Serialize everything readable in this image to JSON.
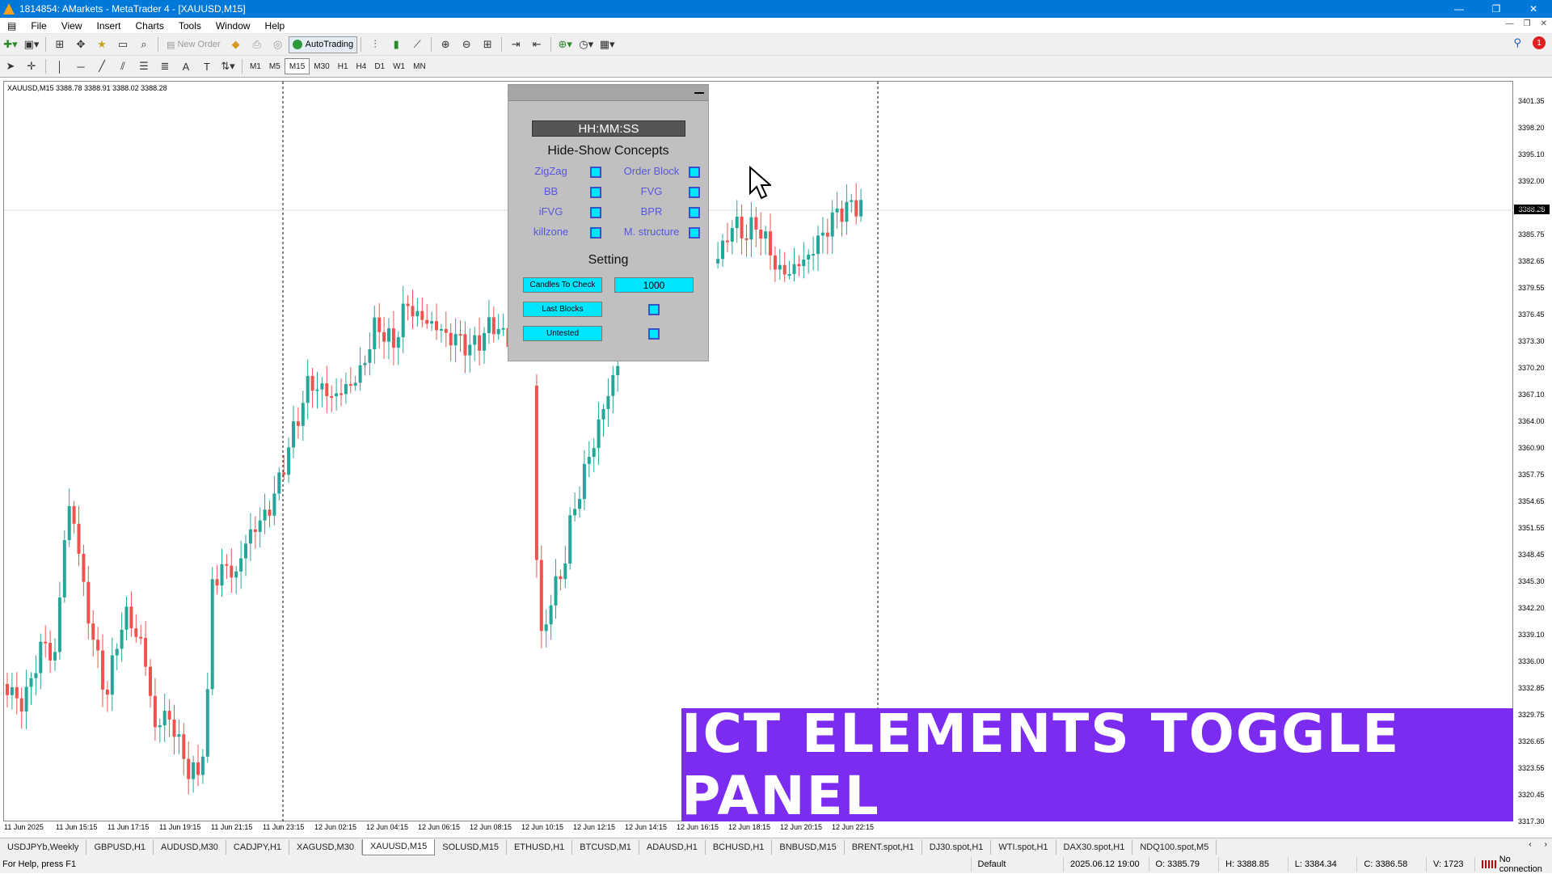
{
  "window": {
    "title": "1814854: AMarkets - MetaTrader 4 - [XAUUSD,M15]",
    "controls": [
      "—",
      "❐",
      "✕"
    ]
  },
  "menu": [
    "File",
    "View",
    "Insert",
    "Charts",
    "Tools",
    "Window",
    "Help"
  ],
  "toolbar": {
    "new_order": "New Order",
    "autotrading": "AutoTrading",
    "notification_count": "1"
  },
  "timeframes": [
    "M1",
    "M5",
    "M15",
    "M30",
    "H1",
    "H4",
    "D1",
    "W1",
    "MN"
  ],
  "active_timeframe": "M15",
  "chart": {
    "info": "XAUUSD,M15  3388.78 3388.91 3388.02 3388.28",
    "current_price": "3388.28",
    "price_ticks": [
      "3401.35",
      "3398.20",
      "3395.10",
      "3392.00",
      "3388.80",
      "3385.75",
      "3382.65",
      "3379.55",
      "3376.45",
      "3373.30",
      "3370.20",
      "3367.10",
      "3364.00",
      "3360.90",
      "3357.75",
      "3354.65",
      "3351.55",
      "3348.45",
      "3345.30",
      "3342.20",
      "3339.10",
      "3336.00",
      "3332.85",
      "3329.75",
      "3326.65",
      "3323.55",
      "3320.45",
      "3317.30"
    ],
    "time_ticks": [
      "11 Jun 2025",
      "11 Jun 15:15",
      "11 Jun 17:15",
      "11 Jun 19:15",
      "11 Jun 21:15",
      "11 Jun 23:15",
      "12 Jun 02:15",
      "12 Jun 04:15",
      "12 Jun 06:15",
      "12 Jun 08:15",
      "12 Jun 10:15",
      "12 Jun 12:15",
      "12 Jun 14:15",
      "12 Jun 16:15",
      "12 Jun 18:15",
      "12 Jun 20:15",
      "12 Jun 22:15"
    ],
    "colors": {
      "bull": "#26a69a",
      "bear": "#ef5350",
      "grid": "#e6e6e6"
    }
  },
  "panel": {
    "timer": "HH:MM:SS",
    "concepts_title": "Hide-Show Concepts",
    "concepts": [
      {
        "label": "ZigZag",
        "checked": true
      },
      {
        "label": "Order Block",
        "checked": true
      },
      {
        "label": "BB",
        "checked": true
      },
      {
        "label": "FVG",
        "checked": true
      },
      {
        "label": "iFVG",
        "checked": true
      },
      {
        "label": "BPR",
        "checked": true
      },
      {
        "label": "killzone",
        "checked": true
      },
      {
        "label": "M. structure",
        "checked": true
      }
    ],
    "setting_title": "Setting",
    "candles_to_check_label": "Candles To Check",
    "candles_to_check_value": "1000",
    "last_blocks_label": "Last Blocks",
    "untested_label": "Untested"
  },
  "chart_tabs": [
    "USDJPYb,Weekly",
    "GBPUSD,H1",
    "AUDUSD,M30",
    "CADJPY,H1",
    "XAGUSD,M30",
    "XAUUSD,M15",
    "SOLUSD,M15",
    "ETHUSD,H1",
    "BTCUSD,M1",
    "ADAUSD,H1",
    "BCHUSD,H1",
    "BNBUSD,M15",
    "BRENT.spot,H1",
    "DJ30.spot,H1",
    "WTI.spot,H1",
    "DAX30.spot,H1",
    "NDQ100.spot,M5"
  ],
  "active_tab": "XAUUSD,M15",
  "status": {
    "help": "For Help, press F1",
    "profile": "Default",
    "datetime": "2025.06.12 19:00",
    "open": "O: 3385.79",
    "high": "H: 3388.85",
    "low": "L: 3384.34",
    "close": "C: 3386.58",
    "volume": "V: 1723",
    "connection": "No connection"
  },
  "banner": "ICT ELEMENTS TOGGLE PANEL"
}
